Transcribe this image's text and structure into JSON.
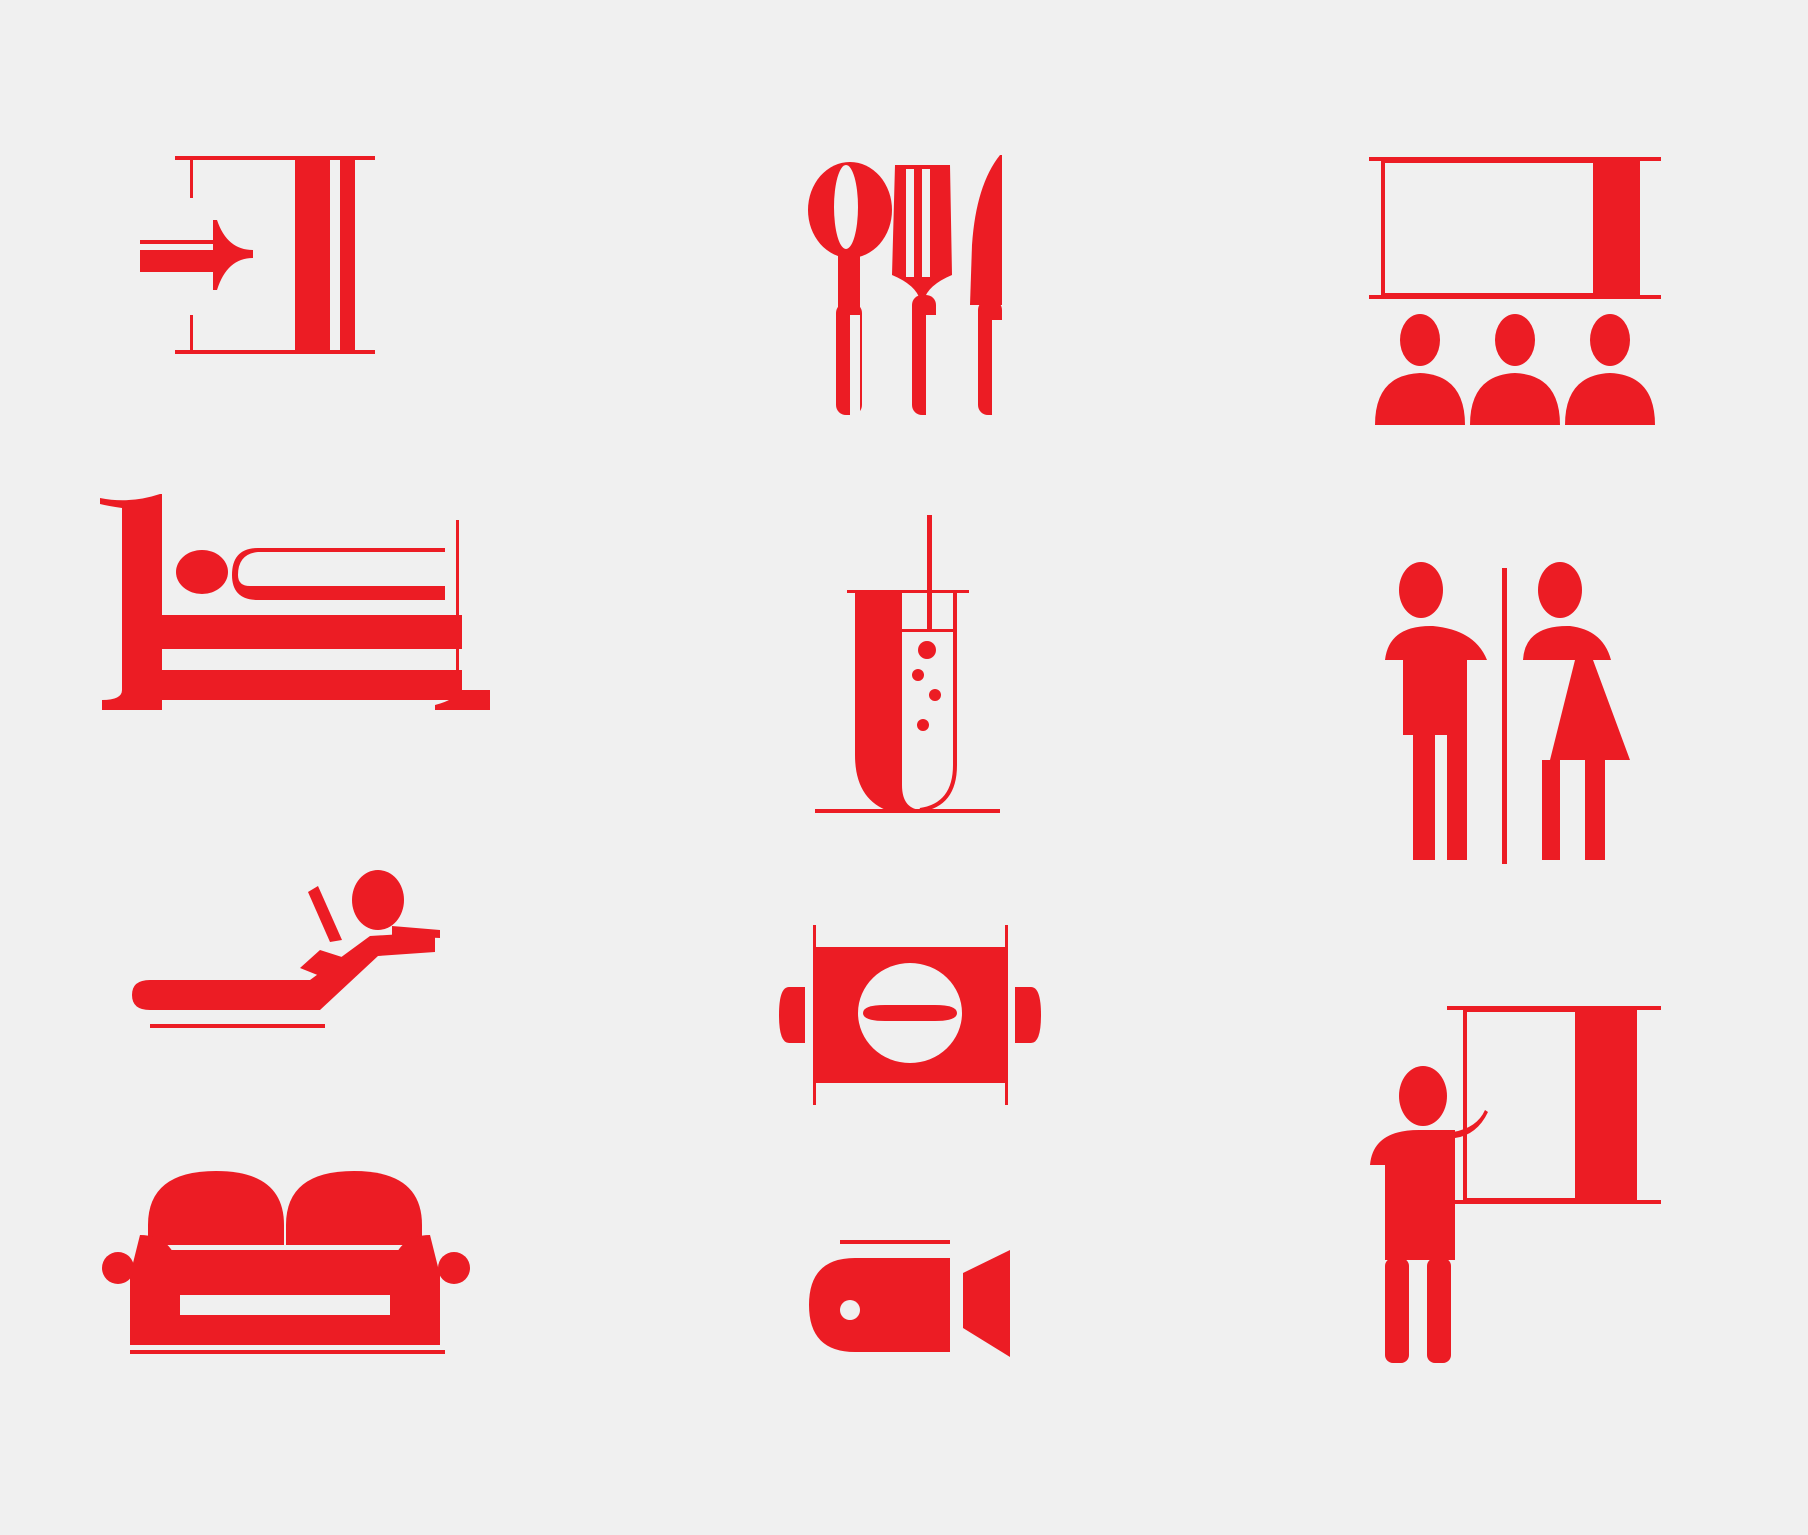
{
  "accent": "#ec1c24",
  "background": "#f0f0f0",
  "icons": [
    {
      "name": "entrance-icon"
    },
    {
      "name": "restaurant-cutlery-icon"
    },
    {
      "name": "cinema-screening-icon"
    },
    {
      "name": "bed-icon"
    },
    {
      "name": "laboratory-test-tube-icon"
    },
    {
      "name": "restroom-icon"
    },
    {
      "name": "sunbed-lounger-icon"
    },
    {
      "name": "sauna-towel-icon"
    },
    {
      "name": "presentation-icon"
    },
    {
      "name": "sofa-icon"
    },
    {
      "name": "video-camera-icon"
    }
  ]
}
